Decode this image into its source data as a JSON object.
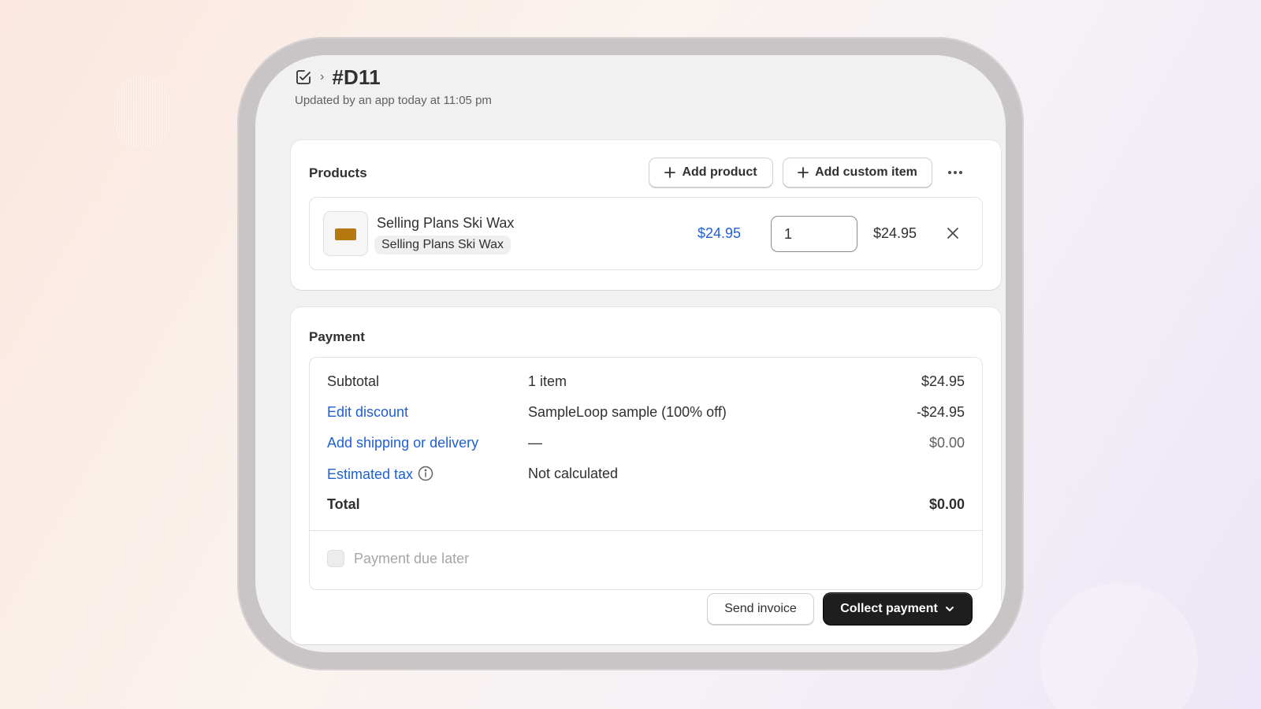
{
  "header": {
    "title": "#D11",
    "subtitle": "Updated by an app today at 11:05 pm",
    "breadcrumb_icon": "draft-order-icon",
    "separator": "›"
  },
  "products": {
    "title": "Products",
    "add_product_label": "Add product",
    "add_custom_item_label": "Add custom item",
    "more_icon": "ellipsis-icon",
    "items": [
      {
        "name": "Selling Plans Ski Wax",
        "variant": "Selling Plans Ski Wax",
        "unit_price": "$24.95",
        "quantity": "1",
        "line_total": "$24.95",
        "thumbnail_color": "#b7790f"
      }
    ]
  },
  "payment": {
    "title": "Payment",
    "rows": [
      {
        "label": "Subtotal",
        "description": "1 item",
        "amount": "$24.95"
      },
      {
        "label": "Edit discount",
        "description": "SampleLoop sample (100% off)",
        "amount": "-$24.95"
      },
      {
        "label": "Add shipping or delivery",
        "description": "—",
        "amount": "$0.00"
      },
      {
        "label": "Estimated tax",
        "description": "Not calculated",
        "amount": ""
      },
      {
        "label": "Total",
        "description": "",
        "amount": "$0.00"
      }
    ],
    "payment_due_later_label": "Payment due later",
    "send_invoice_label": "Send invoice",
    "collect_payment_label": "Collect payment"
  },
  "colors": {
    "link": "#1f5fd1",
    "primary_button": "#1e1e1e",
    "text": "#303030"
  }
}
